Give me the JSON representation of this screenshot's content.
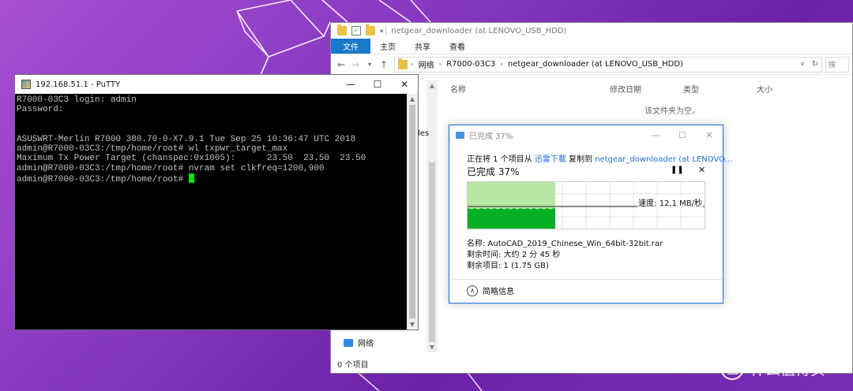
{
  "explorer": {
    "title": "netgear_downloader (at LENOVO_USB_HDD)",
    "ribbon_tabs": [
      "文件",
      "主页",
      "共享",
      "查看"
    ],
    "breadcrumbs": [
      "网络",
      "R7000-03C3",
      "netgear_downloader (at LENOVO_USB_HDD)"
    ],
    "search_placeholder": "搜",
    "columns": [
      "名称",
      "修改日期",
      "类型",
      "大小"
    ],
    "empty_message": "该文件夹为空。",
    "nav_network": "网络",
    "nav_peek": "les",
    "status": "0 个项目"
  },
  "putty": {
    "title": "192.168.51.1 - PuTTY",
    "lines": [
      "R7000-03C3 login: admin",
      "Password:",
      "",
      "",
      "ASUSWRT-Merlin R7000 380.70-0-X7.9.1 Tue Sep 25 10:36:47 UTC 2018",
      "admin@R7000-03C3:/tmp/home/root# wl txpwr_target_max",
      "Maximum Tx Power Target (chanspec:0x1005):      23.50  23.50  23.50",
      "admin@R7000-03C3:/tmp/home/root# nvram set clkfreq=1200,900",
      "admin@R7000-03C3:/tmp/home/root# "
    ]
  },
  "copy_dialog": {
    "title": "已完成 37%",
    "line1_prefix": "正在将 1 个项目从 ",
    "source": "迅雷下载",
    "line1_mid": " 复制到 ",
    "destination": "netgear_downloader (at LENOVO...",
    "percent_text": "已完成 37%",
    "progress": 0.37,
    "speed": "速度: 12.1 MB/秒",
    "name_line": "名称: AutoCAD_2019_Chinese_Win_64bit-32bit.rar",
    "time_line": "剩余时间: 大约 2 分 45 秒",
    "items_line": "剩余项目: 1 (1.75 GB)",
    "more_info": "简略信息",
    "accent": "#1b6fd4",
    "fill_color": "#06b025"
  },
  "watermark": {
    "logo_glyph": "值",
    "text": "什么值得买"
  }
}
